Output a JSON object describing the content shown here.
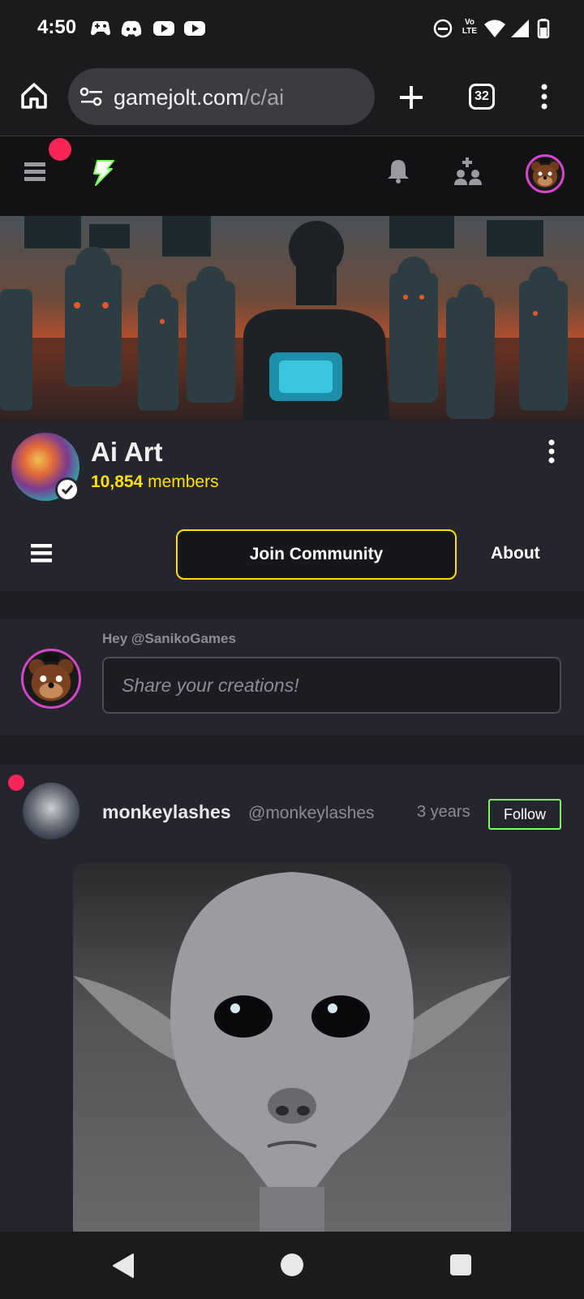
{
  "status_bar": {
    "time": "4:50",
    "notification_icons": [
      "game-controller-icon",
      "discord-icon",
      "youtube-icon",
      "youtube-icon"
    ],
    "system_icons": [
      "do-not-disturb-icon",
      "volte-icon",
      "wifi-icon",
      "signal-icon",
      "battery-icon"
    ],
    "volte_label": "Vo LTE"
  },
  "browser": {
    "url_domain": "gamejolt.com",
    "url_path": "/c/ai",
    "tab_count": "32"
  },
  "community": {
    "title": "Ai Art",
    "member_count": "10,854",
    "member_label": "members",
    "join_label": "Join Community",
    "about_label": "About"
  },
  "composer": {
    "greeting": "Hey @SanikoGames",
    "placeholder": "Share your creations!"
  },
  "post": {
    "author_name": "monkeylashes",
    "author_handle": "@monkeylashes",
    "time": "3 years",
    "follow_label": "Follow"
  },
  "colors": {
    "accent_yellow": "#ffe100",
    "follow_green": "#7bff5e",
    "notification_red": "#ff2457",
    "avatar_ring": "#d447c9"
  }
}
